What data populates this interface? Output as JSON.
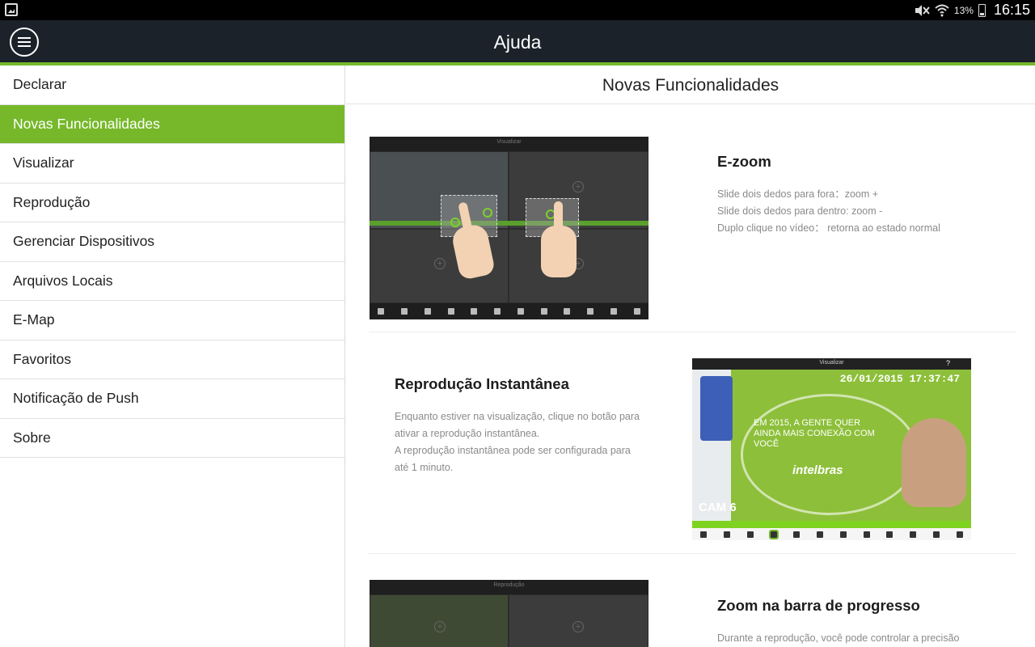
{
  "status_bar": {
    "battery_pct": "13%",
    "time": "16:15"
  },
  "app_bar": {
    "title": "Ajuda"
  },
  "colors": {
    "accent": "#76b82a",
    "appbar": "#1b222a"
  },
  "sidebar": {
    "items": [
      {
        "label": "Declarar",
        "active": false
      },
      {
        "label": "Novas Funcionalidades",
        "active": true
      },
      {
        "label": "Visualizar",
        "active": false
      },
      {
        "label": "Reprodução",
        "active": false
      },
      {
        "label": "Gerenciar Dispositivos",
        "active": false
      },
      {
        "label": "Arquivos Locais",
        "active": false
      },
      {
        "label": "E-Map",
        "active": false
      },
      {
        "label": "Favoritos",
        "active": false
      },
      {
        "label": "Notificação de Push",
        "active": false
      },
      {
        "label": "Sobre",
        "active": false
      }
    ]
  },
  "content": {
    "header": "Novas Funcionalidades",
    "features": [
      {
        "title": "E-zoom",
        "lines": [
          "Slide dois dedos para fora：zoom +",
          "Slide dois dedos para dentro: zoom -",
          "Duplo clique no vídeo： retorna ao estado normal"
        ],
        "image_title": "Visualizar"
      },
      {
        "title": "Reprodução Instantânea",
        "lines": [
          "Enquanto estiver na visualização, clique no botão para",
          "ativar a reprodução instantânea.",
          "A reprodução instantânea pode ser configurada para",
          "até 1 minuto."
        ],
        "image_title": "Visualizar",
        "image_timestamp": "26/01/2015 17:37:47",
        "image_cam": "CAM 6",
        "image_banner": "EM 2015, A GENTE QUER AINDA MAIS CONEXÃO COM VOCÊ",
        "image_brand": "intelbras"
      },
      {
        "title": "Zoom na barra de progresso",
        "lines": [
          "Durante a reprodução, você pode controlar a precisão"
        ],
        "image_title": "Reprodução"
      }
    ]
  }
}
